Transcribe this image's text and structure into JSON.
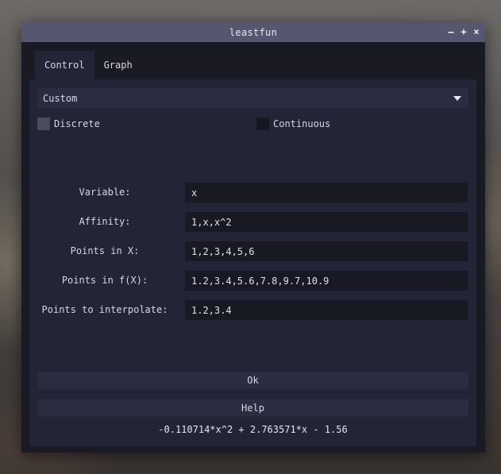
{
  "window": {
    "title": "leastfun",
    "controls": {
      "minimize": "–",
      "maximize": "+",
      "close": "×"
    }
  },
  "tabs": [
    {
      "label": "Control",
      "active": true
    },
    {
      "label": "Graph",
      "active": false
    }
  ],
  "mode_select": {
    "value": "Custom"
  },
  "checkboxes": {
    "discrete": {
      "label": "Discrete",
      "checked": true
    },
    "continuous": {
      "label": "Continuous",
      "checked": false
    }
  },
  "form": {
    "variable": {
      "label": "Variable:",
      "value": "x"
    },
    "affinity": {
      "label": "Affinity:",
      "value": "1,x,x^2"
    },
    "points_x": {
      "label": "Points in X:",
      "value": "1,2,3,4,5,6"
    },
    "points_fx": {
      "label": "Points in f(X):",
      "value": "1.2,3.4,5.6,7.8,9.7,10.9"
    },
    "points_interp": {
      "label": "Points to interpolate:",
      "value": "1.2,3.4"
    }
  },
  "buttons": {
    "ok": "Ok",
    "help": "Help"
  },
  "result": "-0.110714*x^2 + 2.763571*x - 1.56",
  "colors": {
    "titlebar": "#565670",
    "panel": "#232436",
    "window": "#191a24",
    "input": "#181922"
  }
}
